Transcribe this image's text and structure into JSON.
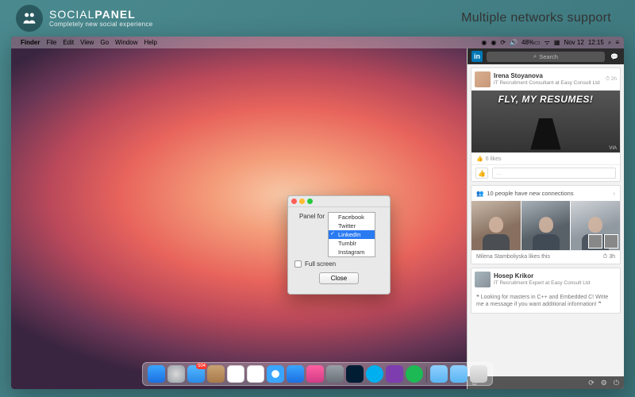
{
  "brand": {
    "name_light": "SOCIAL",
    "name_bold": "PANEL",
    "tagline": "Completely new social experience"
  },
  "headline": "Multiple networks support",
  "menubar": {
    "app": "Finder",
    "items": [
      "File",
      "Edit",
      "View",
      "Go",
      "Window",
      "Help"
    ],
    "battery": "48%",
    "date": "Nov 12",
    "time": "12:15"
  },
  "prefs": {
    "label": "Panel for",
    "options": [
      "Facebook",
      "Twitter",
      "LinkedIn",
      "Tumblr",
      "Instagram"
    ],
    "selected": "LinkedIn",
    "fullscreen_label": "Full screen",
    "close": "Close"
  },
  "panel": {
    "search_placeholder": "Search",
    "post1": {
      "name": "Irena Stoyanova",
      "subtitle": "IT Recruitment Consultant at Easy Consult Ltd",
      "time": "2h",
      "hero_text": "FLY, MY RESUMES!",
      "via": "VIA",
      "likes": "6 likes",
      "comment_ph": "…"
    },
    "connections": {
      "text": "10 people have new connections"
    },
    "like_line": {
      "text": "Milena Stamboliyska likes this",
      "time": "3h"
    },
    "post2": {
      "name": "Hosep Krikor",
      "subtitle": "IT Recruitment Expert at Easy Consult Ltd",
      "body": "Looking for masters in C++ and Embedded C! Write me a message if you want additional information!"
    }
  },
  "dock": {
    "mail_badge": "504"
  }
}
